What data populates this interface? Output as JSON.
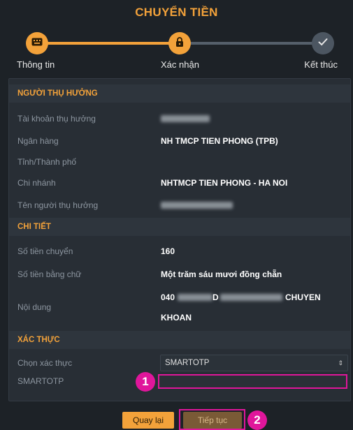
{
  "page": {
    "title": "CHUYỂN TIỀN"
  },
  "stepper": {
    "steps": [
      {
        "label": "Thông tin",
        "icon": "keyboard-icon",
        "state": "done"
      },
      {
        "label": "Xác nhận",
        "icon": "lock-icon",
        "state": "active"
      },
      {
        "label": "Kết thúc",
        "icon": "check-icon",
        "state": "pending"
      }
    ]
  },
  "beneficiary": {
    "heading": "NGƯỜI THỤ HƯỞNG",
    "account_label": "Tài khoản thụ hưởng",
    "bank_label": "Ngân hàng",
    "bank_value": "NH TMCP TIEN PHONG (TPB)",
    "province_label": "Tỉnh/Thành phố",
    "branch_label": "Chi nhánh",
    "branch_value": "NHTMCP TIEN PHONG - HA NOI",
    "name_label": "Tên người thụ hưởng"
  },
  "details": {
    "heading": "CHI TIẾT",
    "amount_label": "Số tiền chuyển",
    "amount_value": "160",
    "amount_words_label": "Số tiền bằng chữ",
    "amount_words_value": "Một trăm sáu mươi đồng chẵn",
    "content_label": "Nội dung",
    "content_prefix": "040",
    "content_mid": "D",
    "content_suffix": "CHUYEN",
    "content_line2": "KHOAN"
  },
  "auth": {
    "heading": "XÁC THỰC",
    "method_label": "Chọn xác thực",
    "method_value": "SMARTOTP",
    "otp_label": "SMARTOTP",
    "otp_value": ""
  },
  "annotations": {
    "badge1": "1",
    "badge2": "2"
  },
  "buttons": {
    "back": "Quay lại",
    "next": "Tiếp tục"
  },
  "colors": {
    "accent": "#f3a23a",
    "highlight": "#e0169b",
    "background": "#1d2227"
  }
}
